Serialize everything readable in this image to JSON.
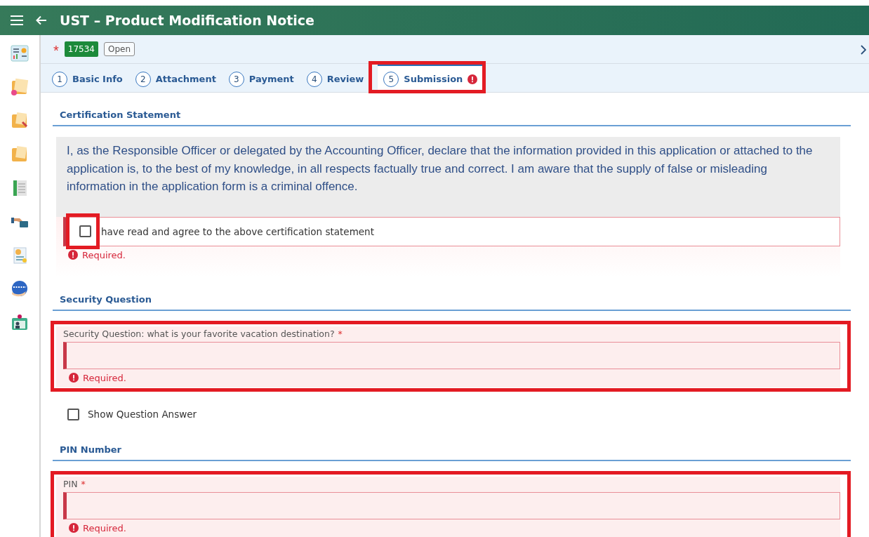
{
  "header": {
    "title": "UST – Product Modification Notice"
  },
  "record": {
    "required_mark": "*",
    "number": "17534",
    "status": "Open"
  },
  "tabs": [
    {
      "number": "1",
      "label": "Basic Info",
      "selected": false,
      "error": false,
      "highlighted": false
    },
    {
      "number": "2",
      "label": "Attachment",
      "selected": false,
      "error": false,
      "highlighted": false
    },
    {
      "number": "3",
      "label": "Payment",
      "selected": false,
      "error": false,
      "highlighted": false
    },
    {
      "number": "4",
      "label": "Review",
      "selected": false,
      "error": false,
      "highlighted": false
    },
    {
      "number": "5",
      "label": "Submission",
      "selected": true,
      "error": true,
      "highlighted": true
    }
  ],
  "certification": {
    "heading": "Certification Statement",
    "statement": "I, as the Responsible Officer or delegated by the Accounting Officer, declare that the information provided in this application or attached to the application is, to the best of my knowledge, in all respects factually true and correct. I am aware that the supply of false or misleading information in the application form is a criminal offence.",
    "agree": {
      "label": "have read and agree to the above certification statement",
      "checked": false,
      "error": "Required.",
      "highlighted": true
    }
  },
  "security": {
    "heading": "Security Question",
    "field": {
      "label": "Security Question: what is your favorite vacation destination?",
      "required_mark": "*",
      "error": "Required.",
      "highlighted": true
    },
    "show_answer": {
      "label": "Show Question Answer",
      "checked": false
    }
  },
  "pin": {
    "heading": "PIN Number",
    "field": {
      "label": "PIN",
      "required_mark": "*",
      "error": "Required.",
      "highlighted": true
    }
  }
}
